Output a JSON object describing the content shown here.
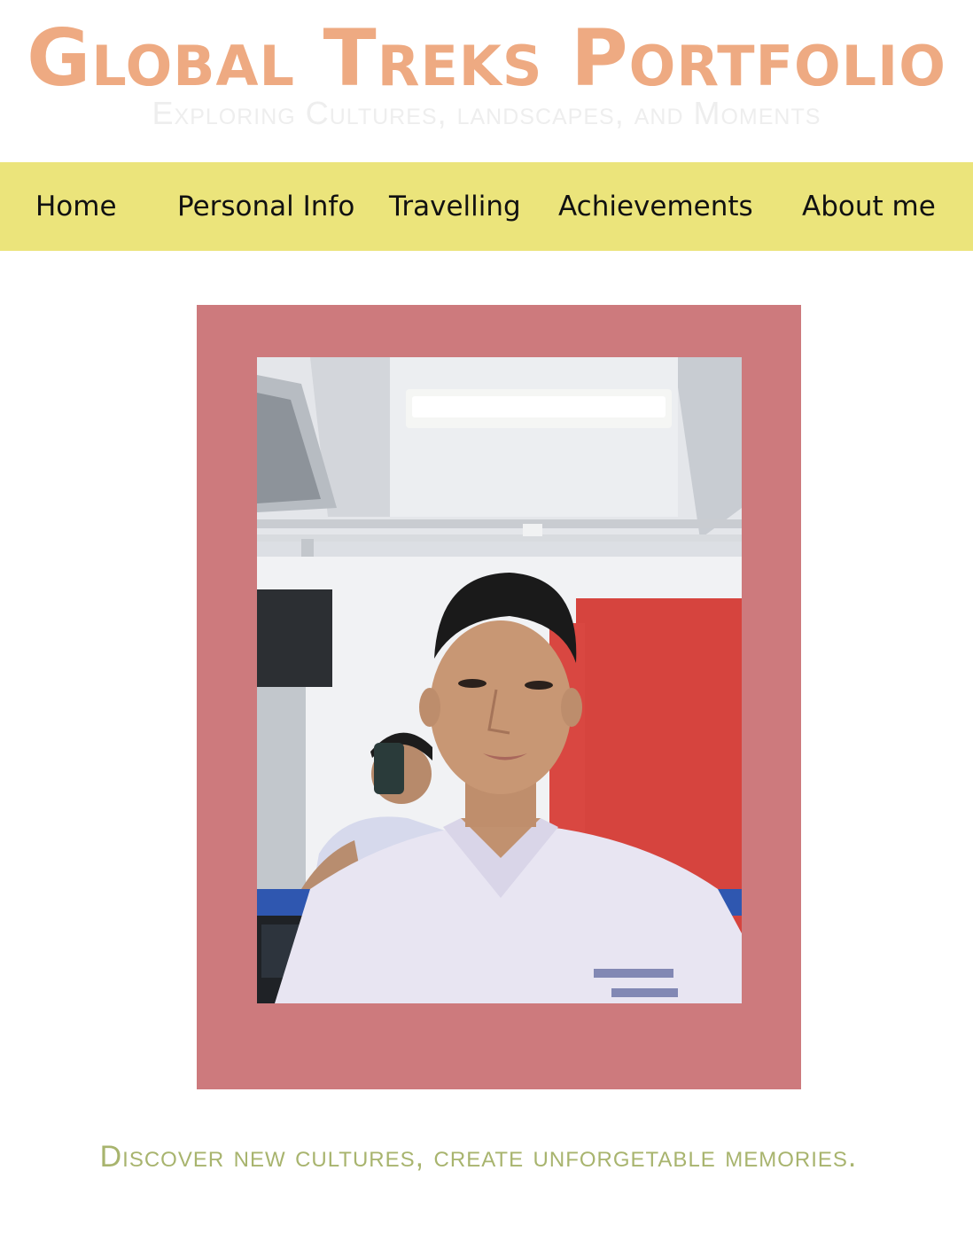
{
  "header": {
    "title": "Global Treks Portfolio",
    "subtitle": "Exploring Cultures, landscapes, and Moments"
  },
  "nav": {
    "items": [
      {
        "label": "Home"
      },
      {
        "label": "Personal Info"
      },
      {
        "label": "Travelling"
      },
      {
        "label": "Achievements"
      },
      {
        "label": "About me"
      }
    ]
  },
  "main": {
    "tagline": "Discover new cultures, create unforgetable memories."
  },
  "colors": {
    "title": "#eeaa82",
    "subtitle": "#eeeeee",
    "nav_background": "#ebe47b",
    "frame": "#cd7a7d",
    "tagline": "#a8b46e"
  }
}
